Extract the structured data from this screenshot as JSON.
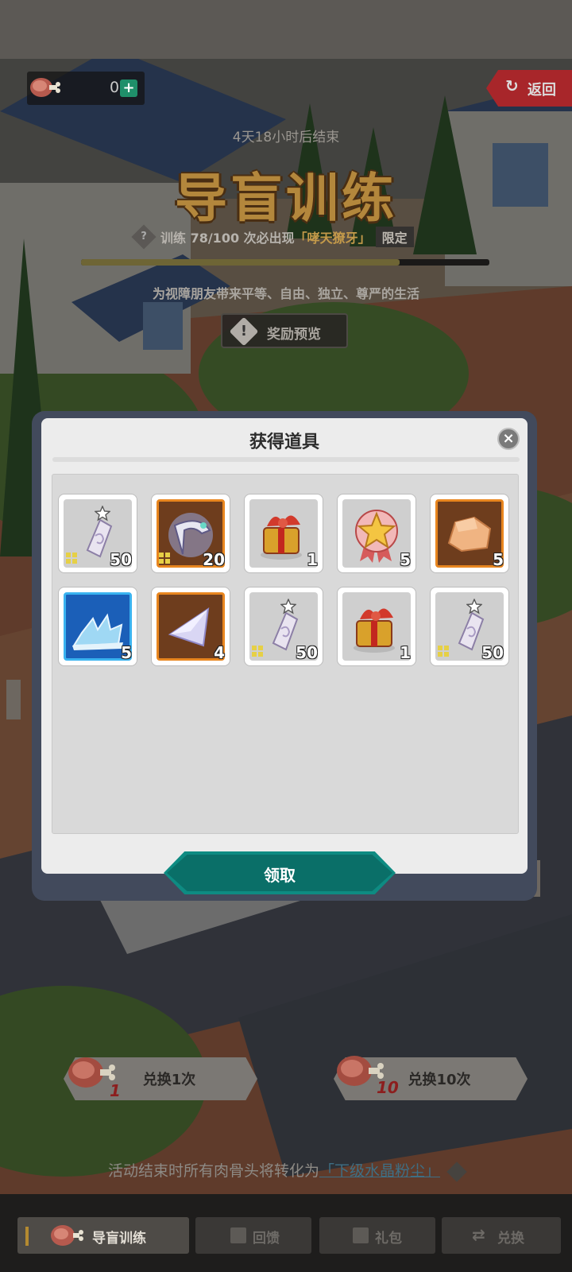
{
  "currency": {
    "icon": "meat-bone-icon",
    "amount": "0",
    "add_icon": "plus-icon"
  },
  "back": {
    "icon": "back-arrow-icon",
    "label": "返回"
  },
  "event": {
    "countdown": "4天18小时后结束",
    "title": "导盲训练",
    "sub_prefix": "训练 78/100 次必出现",
    "sub_highlight": "「哮天獠牙」",
    "sub_badge": "限定",
    "progress": 0.78,
    "slogan": "为视障朋友带来平等、自由、独立、尊严的生活",
    "preview_label": "奖励预览"
  },
  "modal": {
    "title": "获得道具",
    "claim_label": "领取",
    "items": [
      {
        "icon": "crystal-pendant-icon",
        "rarity": "gray",
        "qty": "50"
      },
      {
        "icon": "fang-relic-icon",
        "rarity": "orange",
        "qty": "20"
      },
      {
        "icon": "red-gift-box-icon",
        "rarity": "gray",
        "qty": "1"
      },
      {
        "icon": "star-medal-icon",
        "rarity": "gray",
        "qty": "5"
      },
      {
        "icon": "gold-ore-icon",
        "rarity": "orange",
        "qty": "5"
      },
      {
        "icon": "blue-crystal-shards-icon",
        "rarity": "blue",
        "qty": "5"
      },
      {
        "icon": "triangle-gem-icon",
        "rarity": "orange",
        "qty": "4"
      },
      {
        "icon": "crystal-pendant-icon",
        "rarity": "gray",
        "qty": "50"
      },
      {
        "icon": "red-gift-box-icon",
        "rarity": "gray",
        "qty": "1"
      },
      {
        "icon": "crystal-pendant-icon",
        "rarity": "gray",
        "qty": "50"
      }
    ]
  },
  "exchange": {
    "once_label": "兑换1次",
    "once_cost": "1",
    "ten_label": "兑换10次",
    "ten_cost": "10"
  },
  "convert_note": {
    "prefix": "活动结束时所有肉骨头将转化为",
    "link": "「下级水晶粉尘」"
  },
  "tabs": [
    {
      "label": "导盲训练",
      "icon": "meat-bone-icon"
    },
    {
      "label": "回馈",
      "icon": "calendar-icon"
    },
    {
      "label": "礼包",
      "icon": "gift-icon"
    },
    {
      "label": "兑换",
      "icon": "swap-arrows-icon"
    }
  ]
}
